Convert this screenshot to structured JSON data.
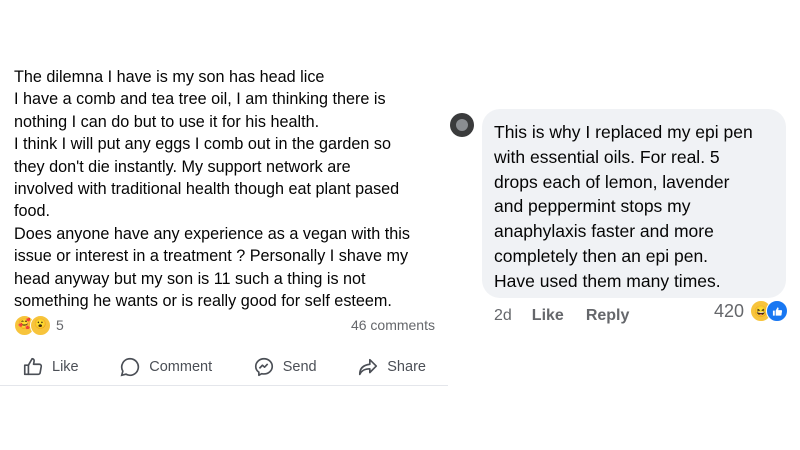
{
  "post": {
    "body_lines": [
      "The dilemna I have is my son has head lice",
      "I have a comb and tea tree oil, I am thinking there is",
      "nothing I can do but to use it for his health.",
      "I think I will put any eggs I comb out in the garden so",
      "they don't die instantly. My support network are",
      "involved with traditional health though eat plant pased",
      "food.",
      "Does anyone have any experience as a vegan with this",
      "issue or interest in a treatment ? Personally I shave my",
      "head anyway but my son is 11 such a thing is not",
      "something he wants or is really good for self esteem."
    ],
    "reaction_count": "5",
    "comments_count": "46 comments",
    "reactions": [
      "care-emoji-icon",
      "wow-emoji-icon"
    ],
    "actions": {
      "like": "Like",
      "comment": "Comment",
      "send": "Send",
      "share": "Share"
    }
  },
  "comment": {
    "text_lines": [
      "This is why I replaced my epi pen",
      "with essential oils. For real. 5",
      "drops each of lemon, lavender",
      "and peppermint stops my",
      "anaphylaxis faster and more",
      "completely then an epi pen.",
      "Have used them many times."
    ],
    "time": "2d",
    "like_label": "Like",
    "reply_label": "Reply",
    "reaction_count": "420",
    "reactions": [
      "haha-emoji-icon",
      "like-reaction-icon"
    ]
  },
  "colors": {
    "bubble_bg": "#f0f2f5",
    "secondary_text": "#65676b",
    "like_blue": "#1877f2",
    "emoji_yellow": "#f7c43c"
  }
}
